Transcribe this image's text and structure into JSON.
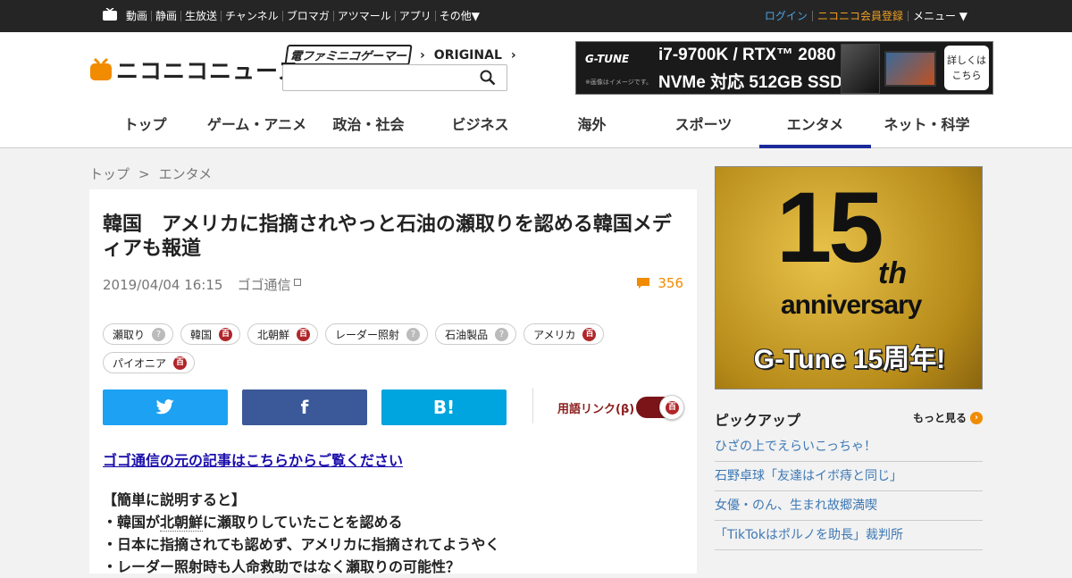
{
  "topbar": {
    "links": [
      "動画",
      "静画",
      "生放送",
      "チャンネル",
      "ブロマガ",
      "アツマール",
      "アプリ",
      "その他▼"
    ],
    "login": "ログイン",
    "register": "ニコニコ会員登録",
    "menu": "メニュー ▼"
  },
  "header": {
    "logo": "ニコニコニュース",
    "brand1": "電ファミニコゲーマー",
    "brand2": "ORIGINAL",
    "search": {
      "placeholder": "",
      "value": ""
    },
    "ad": {
      "brand": "G-TUNE",
      "note": "※画像はイメージです。",
      "line1": "i7-9700K / RTX™ 2080",
      "line2": "NVMe 対応 512GB SSD",
      "button_l1": "詳しくは",
      "button_l2": "こちら"
    },
    "nav": [
      "トップ",
      "ゲーム・アニメ",
      "政治・社会",
      "ビジネス",
      "海外",
      "スポーツ",
      "エンタメ",
      "ネット・科学"
    ],
    "nav_active": 6
  },
  "breadcrumb": {
    "home": "トップ",
    "sep": ">",
    "current": "エンタメ"
  },
  "article": {
    "title": "韓国　アメリカに指摘されやっと石油の瀬取りを認める韓国メディアも報道",
    "date": "2019/04/04 16:15",
    "source": "ゴゴ通信",
    "comments": "356",
    "tags": [
      {
        "label": "瀬取り",
        "type": "q"
      },
      {
        "label": "韓国",
        "type": "hyaku"
      },
      {
        "label": "北朝鮮",
        "type": "hyaku"
      },
      {
        "label": "レーダー照射",
        "type": "q"
      },
      {
        "label": "石油製品",
        "type": "q"
      },
      {
        "label": "アメリカ",
        "type": "hyaku"
      },
      {
        "label": "パイオニア",
        "type": "hyaku"
      }
    ],
    "share": {
      "twitter": "twitter",
      "facebook": "f",
      "hatena": "B!"
    },
    "yogo_label": "用語リンク(β)",
    "orig_link": "ゴゴ通信の元の記事はこちらからご覧ください",
    "summary_head": "【簡単に説明すると】",
    "points": [
      {
        "pre": "・韓国が",
        "kw": "北朝鮮",
        "post": "に瀬取りしていたことを認める"
      },
      {
        "pre": "・日本に指摘されても認めず、アメリカに指摘されてようやく",
        "kw": "",
        "post": ""
      },
      {
        "pre": "・レーダー照射時も人命救助ではなく瀬取りの可能性？",
        "kw": "",
        "post": ""
      }
    ]
  },
  "sidebar": {
    "ad": {
      "big": "15",
      "th": "th",
      "anniv": "anniversary",
      "tag": "G-Tune 15周年!"
    },
    "pickup_title": "ピックアップ",
    "more": "もっと見る",
    "pickups": [
      "ひざの上でえらいこっちゃ！",
      "石野卓球「友達はイボ痔と同じ」",
      "女優・のん、生まれ故郷満喫",
      "「TikTokはポルノを助長」裁判所"
    ]
  }
}
